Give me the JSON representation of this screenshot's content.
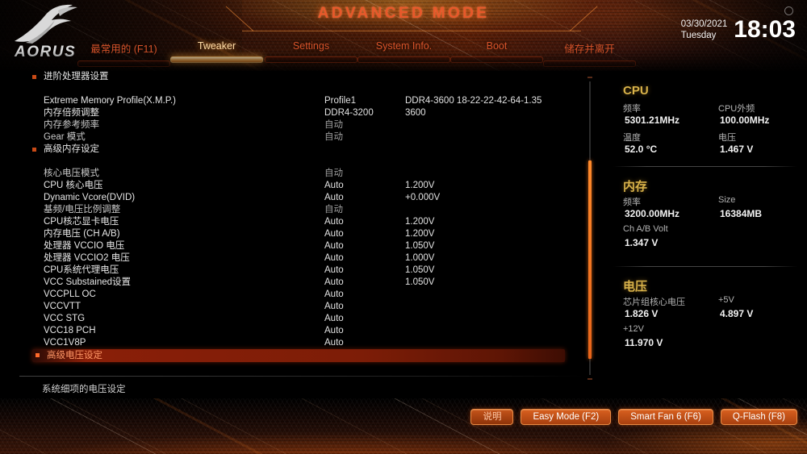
{
  "header": {
    "mode_title": "ADVANCED MODE",
    "brand": "AORUS",
    "date": "03/30/2021",
    "weekday": "Tuesday",
    "time": "18:03",
    "gear_icon": "gear-icon",
    "tabs": [
      {
        "label": "最常用的 (F11)",
        "active": false
      },
      {
        "label": "Tweaker",
        "active": true
      },
      {
        "label": "Settings",
        "active": false
      },
      {
        "label": "System Info.",
        "active": false
      },
      {
        "label": "Boot",
        "active": false
      },
      {
        "label": "储存并离开",
        "active": false
      }
    ]
  },
  "main": {
    "rows": [
      {
        "name": "进阶处理器设置",
        "bullet": true,
        "value1": "",
        "value2": "",
        "dim": false,
        "selected": false
      },
      {
        "name": "",
        "bullet": false,
        "value1": "",
        "value2": "",
        "dim": false,
        "selected": false
      },
      {
        "name": "Extreme Memory Profile(X.M.P.)",
        "bullet": false,
        "value1": "Profile1",
        "value2": "DDR4-3600 18-22-22-42-64-1.35",
        "dim": false,
        "selected": false
      },
      {
        "name": "内存倍频调整",
        "bullet": false,
        "value1": "DDR4-3200",
        "value2": "3600",
        "dim": false,
        "selected": false
      },
      {
        "name": "内存参考频率",
        "bullet": false,
        "value1": "自动",
        "value2": "",
        "dim": true,
        "selected": false
      },
      {
        "name": "Gear 模式",
        "bullet": false,
        "value1": "自动",
        "value2": "",
        "dim": true,
        "selected": false
      },
      {
        "name": "高级内存设定",
        "bullet": true,
        "value1": "",
        "value2": "",
        "dim": false,
        "selected": false
      },
      {
        "name": "",
        "bullet": false,
        "value1": "",
        "value2": "",
        "dim": false,
        "selected": false
      },
      {
        "name": "核心电压模式",
        "bullet": false,
        "value1": "自动",
        "value2": "",
        "dim": true,
        "selected": false
      },
      {
        "name": "CPU 核心电压",
        "bullet": false,
        "value1": "Auto",
        "value2": "1.200V",
        "dim": false,
        "selected": false
      },
      {
        "name": "Dynamic Vcore(DVID)",
        "bullet": false,
        "value1": "Auto",
        "value2": "+0.000V",
        "dim": false,
        "selected": false
      },
      {
        "name": "基频/电压比例调整",
        "bullet": false,
        "value1": "自动",
        "value2": "",
        "dim": true,
        "selected": false
      },
      {
        "name": "CPU核芯显卡电压",
        "bullet": false,
        "value1": "Auto",
        "value2": "1.200V",
        "dim": false,
        "selected": false
      },
      {
        "name": "内存电压 (CH A/B)",
        "bullet": false,
        "value1": "Auto",
        "value2": "1.200V",
        "dim": false,
        "selected": false
      },
      {
        "name": "处理器 VCCIO 电压",
        "bullet": false,
        "value1": "Auto",
        "value2": "1.050V",
        "dim": false,
        "selected": false
      },
      {
        "name": "处理器 VCCIO2 电压",
        "bullet": false,
        "value1": "Auto",
        "value2": "1.000V",
        "dim": false,
        "selected": false
      },
      {
        "name": "CPU系统代理电压",
        "bullet": false,
        "value1": "Auto",
        "value2": "1.050V",
        "dim": false,
        "selected": false
      },
      {
        "name": "VCC Substained设置",
        "bullet": false,
        "value1": "Auto",
        "value2": "1.050V",
        "dim": false,
        "selected": false
      },
      {
        "name": "VCCPLL OC",
        "bullet": false,
        "value1": "Auto",
        "value2": "",
        "dim": false,
        "selected": false
      },
      {
        "name": "VCCVTT",
        "bullet": false,
        "value1": "Auto",
        "value2": "",
        "dim": false,
        "selected": false
      },
      {
        "name": "VCC STG",
        "bullet": false,
        "value1": "Auto",
        "value2": "",
        "dim": false,
        "selected": false
      },
      {
        "name": "VCC18 PCH",
        "bullet": false,
        "value1": "Auto",
        "value2": "",
        "dim": false,
        "selected": false
      },
      {
        "name": "VCC1V8P",
        "bullet": false,
        "value1": "Auto",
        "value2": "",
        "dim": false,
        "selected": false
      },
      {
        "name": "高级电压设定",
        "bullet": true,
        "value1": "",
        "value2": "",
        "dim": false,
        "selected": true
      }
    ],
    "help_text": "系统细项的电压设定"
  },
  "sidebar": {
    "groups": [
      {
        "title": "CPU",
        "fields": [
          {
            "label": "频率",
            "value": "5301.21MHz"
          },
          {
            "label": "CPU外频",
            "value": "100.00MHz"
          },
          {
            "label": "温度",
            "value": "52.0 °C"
          },
          {
            "label": "电压",
            "value": "1.467 V"
          }
        ]
      },
      {
        "title": "内存",
        "fields": [
          {
            "label": "频率",
            "value": "3200.00MHz"
          },
          {
            "label": "Size",
            "value": "16384MB"
          },
          {
            "label": "Ch A/B Volt",
            "value": "1.347 V"
          }
        ]
      },
      {
        "title": "电压",
        "fields": [
          {
            "label": "芯片组核心电压",
            "value": "1.826 V"
          },
          {
            "label": "+5V",
            "value": "4.897 V"
          },
          {
            "label": "+12V",
            "value": "11.970 V"
          }
        ]
      }
    ]
  },
  "footer": {
    "buttons": [
      {
        "label": "说明",
        "muted": true
      },
      {
        "label": "Easy Mode (F2)",
        "muted": false
      },
      {
        "label": "Smart Fan 6 (F6)",
        "muted": false
      },
      {
        "label": "Q-Flash (F8)",
        "muted": false
      }
    ]
  },
  "colors": {
    "accent_orange": "#e8582a",
    "tab_active": "#ffdca6",
    "group_title": "#d8b24a",
    "selected_row": "#8a1f08"
  }
}
